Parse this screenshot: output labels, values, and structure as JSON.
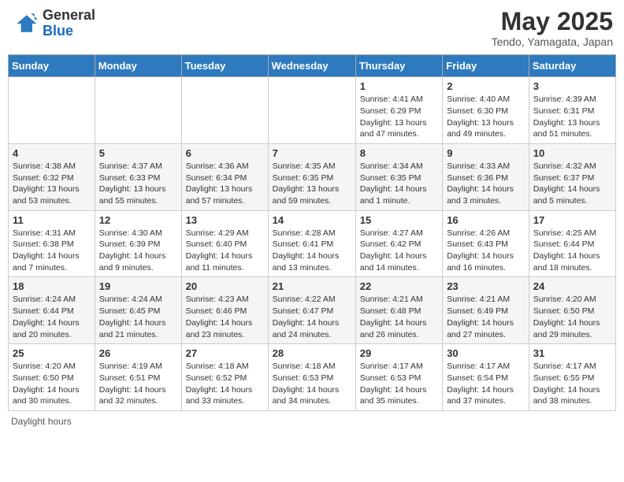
{
  "header": {
    "logo_general": "General",
    "logo_blue": "Blue",
    "month_title": "May 2025",
    "subtitle": "Tendo, Yamagata, Japan"
  },
  "weekdays": [
    "Sunday",
    "Monday",
    "Tuesday",
    "Wednesday",
    "Thursday",
    "Friday",
    "Saturday"
  ],
  "weeks": [
    [
      {
        "day": "",
        "info": ""
      },
      {
        "day": "",
        "info": ""
      },
      {
        "day": "",
        "info": ""
      },
      {
        "day": "",
        "info": ""
      },
      {
        "day": "1",
        "info": "Sunrise: 4:41 AM\nSunset: 6:29 PM\nDaylight: 13 hours\nand 47 minutes."
      },
      {
        "day": "2",
        "info": "Sunrise: 4:40 AM\nSunset: 6:30 PM\nDaylight: 13 hours\nand 49 minutes."
      },
      {
        "day": "3",
        "info": "Sunrise: 4:39 AM\nSunset: 6:31 PM\nDaylight: 13 hours\nand 51 minutes."
      }
    ],
    [
      {
        "day": "4",
        "info": "Sunrise: 4:38 AM\nSunset: 6:32 PM\nDaylight: 13 hours\nand 53 minutes."
      },
      {
        "day": "5",
        "info": "Sunrise: 4:37 AM\nSunset: 6:33 PM\nDaylight: 13 hours\nand 55 minutes."
      },
      {
        "day": "6",
        "info": "Sunrise: 4:36 AM\nSunset: 6:34 PM\nDaylight: 13 hours\nand 57 minutes."
      },
      {
        "day": "7",
        "info": "Sunrise: 4:35 AM\nSunset: 6:35 PM\nDaylight: 13 hours\nand 59 minutes."
      },
      {
        "day": "8",
        "info": "Sunrise: 4:34 AM\nSunset: 6:35 PM\nDaylight: 14 hours\nand 1 minute."
      },
      {
        "day": "9",
        "info": "Sunrise: 4:33 AM\nSunset: 6:36 PM\nDaylight: 14 hours\nand 3 minutes."
      },
      {
        "day": "10",
        "info": "Sunrise: 4:32 AM\nSunset: 6:37 PM\nDaylight: 14 hours\nand 5 minutes."
      }
    ],
    [
      {
        "day": "11",
        "info": "Sunrise: 4:31 AM\nSunset: 6:38 PM\nDaylight: 14 hours\nand 7 minutes."
      },
      {
        "day": "12",
        "info": "Sunrise: 4:30 AM\nSunset: 6:39 PM\nDaylight: 14 hours\nand 9 minutes."
      },
      {
        "day": "13",
        "info": "Sunrise: 4:29 AM\nSunset: 6:40 PM\nDaylight: 14 hours\nand 11 minutes."
      },
      {
        "day": "14",
        "info": "Sunrise: 4:28 AM\nSunset: 6:41 PM\nDaylight: 14 hours\nand 13 minutes."
      },
      {
        "day": "15",
        "info": "Sunrise: 4:27 AM\nSunset: 6:42 PM\nDaylight: 14 hours\nand 14 minutes."
      },
      {
        "day": "16",
        "info": "Sunrise: 4:26 AM\nSunset: 6:43 PM\nDaylight: 14 hours\nand 16 minutes."
      },
      {
        "day": "17",
        "info": "Sunrise: 4:25 AM\nSunset: 6:44 PM\nDaylight: 14 hours\nand 18 minutes."
      }
    ],
    [
      {
        "day": "18",
        "info": "Sunrise: 4:24 AM\nSunset: 6:44 PM\nDaylight: 14 hours\nand 20 minutes."
      },
      {
        "day": "19",
        "info": "Sunrise: 4:24 AM\nSunset: 6:45 PM\nDaylight: 14 hours\nand 21 minutes."
      },
      {
        "day": "20",
        "info": "Sunrise: 4:23 AM\nSunset: 6:46 PM\nDaylight: 14 hours\nand 23 minutes."
      },
      {
        "day": "21",
        "info": "Sunrise: 4:22 AM\nSunset: 6:47 PM\nDaylight: 14 hours\nand 24 minutes."
      },
      {
        "day": "22",
        "info": "Sunrise: 4:21 AM\nSunset: 6:48 PM\nDaylight: 14 hours\nand 26 minutes."
      },
      {
        "day": "23",
        "info": "Sunrise: 4:21 AM\nSunset: 6:49 PM\nDaylight: 14 hours\nand 27 minutes."
      },
      {
        "day": "24",
        "info": "Sunrise: 4:20 AM\nSunset: 6:50 PM\nDaylight: 14 hours\nand 29 minutes."
      }
    ],
    [
      {
        "day": "25",
        "info": "Sunrise: 4:20 AM\nSunset: 6:50 PM\nDaylight: 14 hours\nand 30 minutes."
      },
      {
        "day": "26",
        "info": "Sunrise: 4:19 AM\nSunset: 6:51 PM\nDaylight: 14 hours\nand 32 minutes."
      },
      {
        "day": "27",
        "info": "Sunrise: 4:18 AM\nSunset: 6:52 PM\nDaylight: 14 hours\nand 33 minutes."
      },
      {
        "day": "28",
        "info": "Sunrise: 4:18 AM\nSunset: 6:53 PM\nDaylight: 14 hours\nand 34 minutes."
      },
      {
        "day": "29",
        "info": "Sunrise: 4:17 AM\nSunset: 6:53 PM\nDaylight: 14 hours\nand 35 minutes."
      },
      {
        "day": "30",
        "info": "Sunrise: 4:17 AM\nSunset: 6:54 PM\nDaylight: 14 hours\nand 37 minutes."
      },
      {
        "day": "31",
        "info": "Sunrise: 4:17 AM\nSunset: 6:55 PM\nDaylight: 14 hours\nand 38 minutes."
      }
    ]
  ],
  "footer": "Daylight hours"
}
